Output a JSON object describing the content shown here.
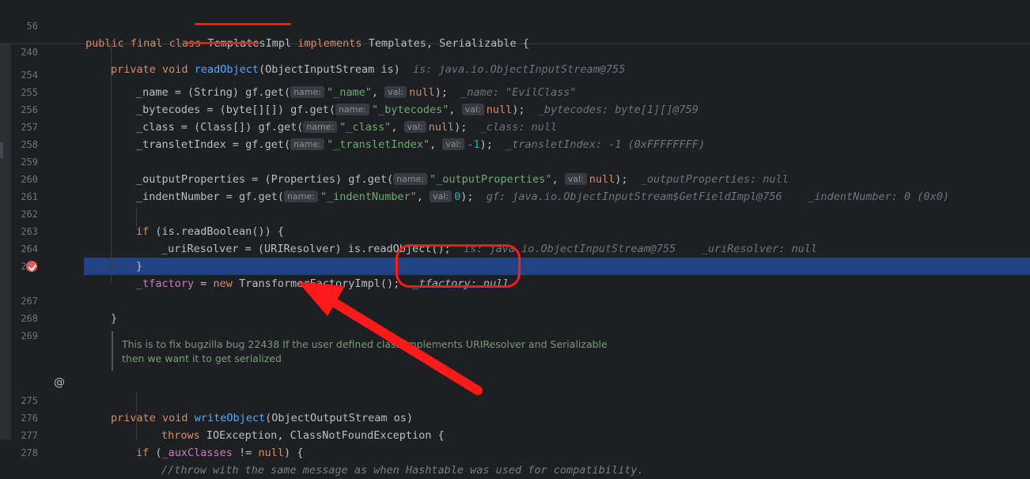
{
  "sticky": {
    "line1": {
      "num": "56",
      "kw1": "public final class",
      "cls": "TemplatesImpl",
      "kw2": "implements",
      "rest": "Templates, Serializable {"
    },
    "line2": {
      "num": "240",
      "kw": "private void",
      "fn": "readObject",
      "args": "(ObjectInputStream is)",
      "inline": "is: java.io.ObjectInputStream@755"
    }
  },
  "lines": {
    "l254": {
      "num": "254",
      "a": "_name",
      "b": " = (String) gf.get(",
      "hint": "name:",
      "str": "\"_name\"",
      "c": ", ",
      "hint2": "val:",
      "d": "null",
      "e": ");",
      "inline": "_name: \"EvilClass\""
    },
    "l255": {
      "num": "255",
      "a": "_bytecodes",
      "b": " = (byte[][]) gf.get(",
      "hint": "name:",
      "str": "\"_bytecodes\"",
      "c": ", ",
      "hint2": "val:",
      "d": "null",
      "e": ");",
      "inline": "_bytecodes: byte[1][]@759"
    },
    "l256": {
      "num": "256",
      "a": "_class",
      "b": " = (Class[]) gf.get(",
      "hint": "name:",
      "str": "\"_class\"",
      "c": ", ",
      "hint2": "val:",
      "d": "null",
      "e": ");",
      "inline": "_class: null"
    },
    "l257": {
      "num": "257",
      "a": "_transletIndex",
      "b": " = gf.get(",
      "hint": "name:",
      "str": "\"_transletIndex\"",
      "c": ", ",
      "hint2": "val:",
      "d": "-1",
      "e": ");",
      "inline": "_transletIndex: -1 (0xFFFFFFFF)"
    },
    "l258": {
      "num": "258"
    },
    "l259": {
      "num": "259",
      "a": "_outputProperties",
      "b": " = (Properties) gf.get(",
      "hint": "name:",
      "str": "\"_outputProperties\"",
      "c": ", ",
      "hint2": "val:",
      "d": "null",
      "e": ");",
      "inline": "_outputProperties: null"
    },
    "l260": {
      "num": "260",
      "a": "_indentNumber",
      "b": " = gf.get(",
      "hint": "name:",
      "str": "\"_indentNumber\"",
      "c": ", ",
      "hint2": "val:",
      "d": "0",
      "e": ");",
      "inline": "gf: java.io.ObjectInputStream$GetFieldImpl@756    _indentNumber: 0 (0x0)"
    },
    "l261": {
      "num": "261"
    },
    "l262": {
      "num": "262",
      "kw": "if",
      "rest": " (is.readBoolean()) {"
    },
    "l263": {
      "num": "263",
      "a": "_uriResolver",
      "rest": " = (URIResolver) is.readObject();",
      "inline": "is: java.io.ObjectInputStream@755    _uriResolver: null"
    },
    "l264": {
      "num": "264",
      "rest": "}"
    },
    "l265": {
      "num": "265"
    },
    "l266": {
      "a": "_tfactory",
      "b": " = ",
      "kw": "new",
      "rest": " TransformerFactoryImpl();",
      "inline": "_tfactory: null"
    },
    "l267": {
      "num": "267",
      "rest": "}"
    },
    "l268": {
      "num": "268"
    },
    "l269": {
      "num": "269"
    },
    "l275": {
      "num": "275",
      "kw": "private void",
      "fn": "writeObject",
      "rest": "(ObjectOutputStream os)"
    },
    "l276": {
      "num": "276",
      "kw": "throws",
      "rest": " IOException, ClassNotFoundException {"
    },
    "l277": {
      "num": "277",
      "kw": "if",
      "a": " (",
      "fld": "_auxClasses",
      "b": " != ",
      "kw2": "null",
      "rest": ") {"
    },
    "l278": {
      "num": "278",
      "rest": "//throw with the same message as when Hashtable was used for compatibility."
    }
  },
  "doc": {
    "line1": "This is to fix bugzilla bug 22438 If the user defined class implements URIResolver and Serializable",
    "line2": "then we want it to get serialized"
  },
  "gutter": {
    "override_symbol": "@"
  },
  "annotation_color": "#ff1a1a",
  "selection_color": "#214283"
}
